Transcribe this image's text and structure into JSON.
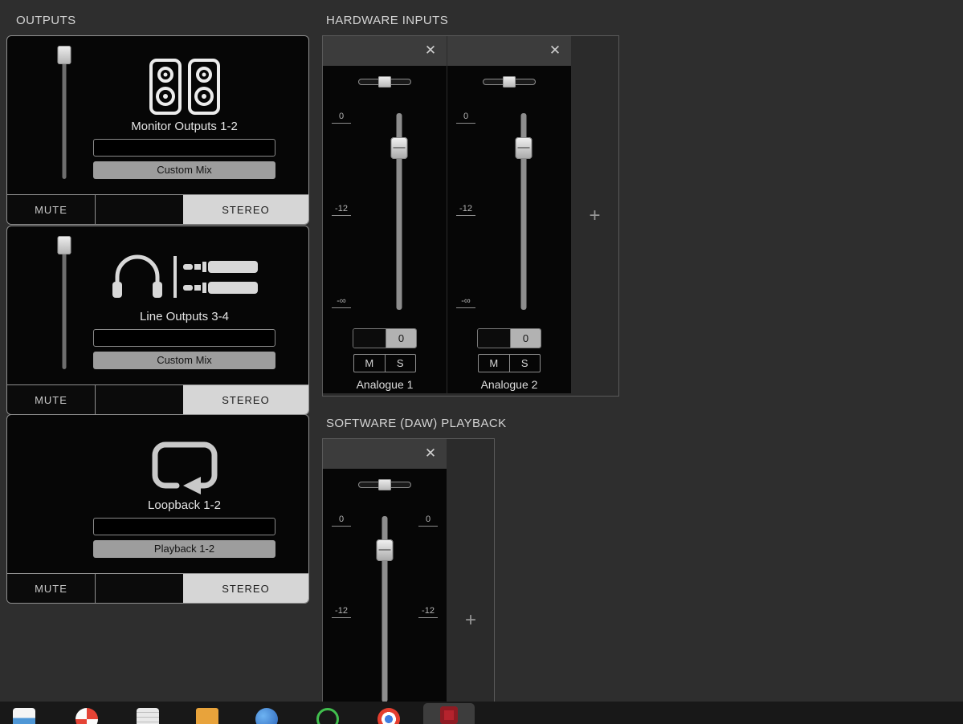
{
  "titles": {
    "outputs": "OUTPUTS",
    "hardware_inputs": "HARDWARE INPUTS",
    "software_playback": "SOFTWARE (DAW) PLAYBACK"
  },
  "icons": {
    "close": "✕",
    "add": "+"
  },
  "colors": {
    "background": "#2e2e2e",
    "panel_black": "#060606",
    "stereo_button": "#d6d6d6",
    "source_button": "#9d9d9d"
  },
  "outputs": [
    {
      "name": "Monitor Outputs 1-2",
      "custom_name_value": "",
      "source": "Custom Mix",
      "mute": "MUTE",
      "stereo": "STEREO"
    },
    {
      "name": "Line Outputs 3-4",
      "custom_name_value": "",
      "source": "Custom Mix",
      "mute": "MUTE",
      "stereo": "STEREO"
    },
    {
      "name": "Loopback 1-2",
      "custom_name_value": "",
      "source": "Playback 1-2",
      "mute": "MUTE",
      "stereo": "STEREO"
    }
  ],
  "hardware_inputs": {
    "channels": [
      {
        "name": "Analogue 1",
        "gain_display": "0",
        "mute": "M",
        "solo": "S",
        "scale": {
          "unity": "0",
          "minus12": "-12",
          "inf": "-∞"
        }
      },
      {
        "name": "Analogue 2",
        "gain_display": "0",
        "mute": "M",
        "solo": "S",
        "scale": {
          "unity": "0",
          "minus12": "-12",
          "inf": "-∞"
        }
      }
    ]
  },
  "software_playback": {
    "channel": {
      "scale_left": {
        "unity": "0",
        "minus12": "-12"
      },
      "scale_right": {
        "unity": "0",
        "minus12": "-12"
      }
    }
  }
}
